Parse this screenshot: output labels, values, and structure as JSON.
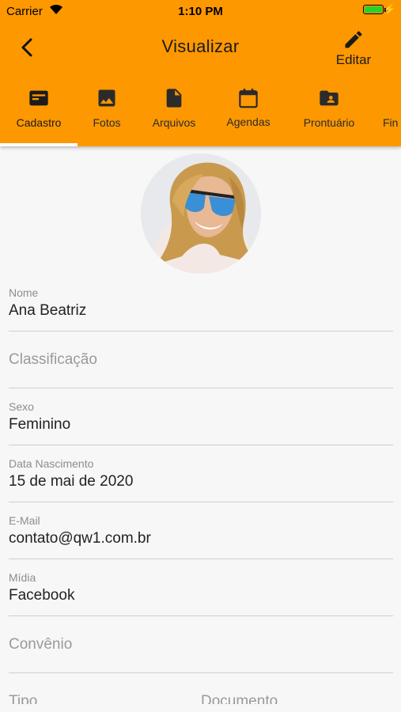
{
  "status_bar": {
    "carrier": "Carrier",
    "time": "1:10 PM"
  },
  "header": {
    "title": "Visualizar",
    "edit_label": "Editar"
  },
  "tabs": [
    {
      "label": "Cadastro",
      "icon": "id-card-icon"
    },
    {
      "label": "Fotos",
      "icon": "image-icon"
    },
    {
      "label": "Arquivos",
      "icon": "file-icon"
    },
    {
      "label": "Agendas",
      "icon": "calendar-icon"
    },
    {
      "label": "Prontuário",
      "icon": "folder-account-icon"
    },
    {
      "label": "Fin",
      "icon": ""
    }
  ],
  "form": {
    "nome": {
      "label": "Nome",
      "value": "Ana Beatriz"
    },
    "classificacao": {
      "placeholder": "Classificação"
    },
    "sexo": {
      "label": "Sexo",
      "value": "Feminino"
    },
    "nascimento": {
      "label": "Data Nascimento",
      "value": "15 de mai de 2020"
    },
    "email": {
      "label": "E-Mail",
      "value": "contato@qw1.com.br"
    },
    "midia": {
      "label": "Mídia",
      "value": "Facebook"
    },
    "convenio": {
      "placeholder": "Convênio"
    },
    "tipo": {
      "placeholder": "Tipo"
    },
    "documento": {
      "placeholder": "Documento"
    }
  },
  "colors": {
    "accent": "#fd9800",
    "background": "#f7f7f7"
  }
}
